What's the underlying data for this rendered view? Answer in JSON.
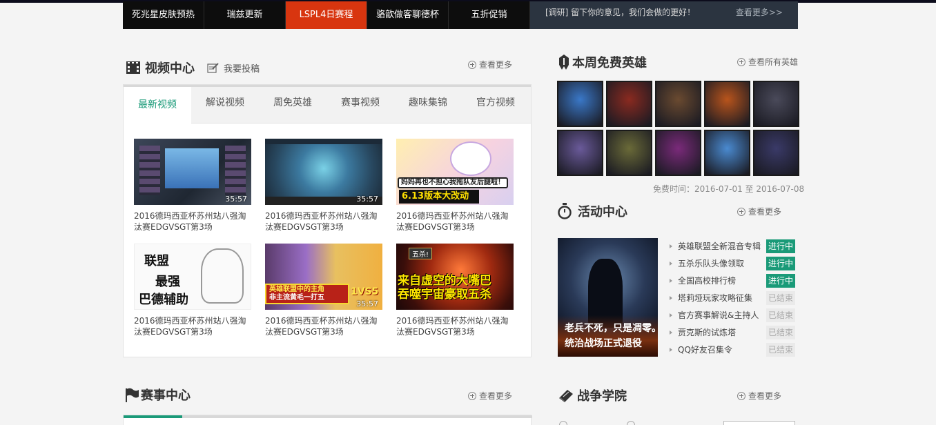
{
  "topnav": {
    "tabs": [
      "死兆星皮肤预热",
      "瑞兹更新",
      "LSPL4日赛程",
      "骆歆做客聊德杯",
      "五折促销"
    ],
    "active_index": 2
  },
  "survey": {
    "text": "[调研] 留下你的意见，我们会做的更好！",
    "more": "查看更多>>"
  },
  "video": {
    "title": "视频中心",
    "submit": "我要投稿",
    "more": "查看更多",
    "tabs": [
      "最新视频",
      "解说视频",
      "周免英雄",
      "赛事视频",
      "趣味集锦",
      "官方视频"
    ],
    "items": [
      {
        "caption": "2016德玛西亚杯苏州站八强淘汰赛EDGVSGT第3场",
        "duration": "35:57",
        "thumb": "match-broadcast"
      },
      {
        "caption": "2016德玛西亚杯苏州站八强淘汰赛EDGVSGT第3场",
        "duration": "35:57",
        "thumb": "gameplay"
      },
      {
        "caption": "2016德玛西亚杯苏州站八强淘汰赛EDGVSGT第3场",
        "duration": "",
        "thumb": "cartoon",
        "banner": "妈妈再也不担心我拖队友后腿啦！",
        "tag": "6.13版本大改动"
      },
      {
        "caption": "2016德玛西亚杯苏州站八强淘汰赛EDGVSGT第3场",
        "duration": "",
        "thumb": "sketch",
        "lines": [
          "联盟",
          "最强",
          "巴德辅助"
        ]
      },
      {
        "caption": "2016德玛西亚杯苏州站八强淘汰赛EDGVSGT第3场",
        "duration": "35:57",
        "thumb": "cosplay",
        "lines": [
          "英雄联盟中的主角",
          "非主流黄毛一打五"
        ],
        "tag": "1VS5"
      },
      {
        "caption": "2016德玛西亚杯苏州站八强淘汰赛EDGVSGT第3场",
        "duration": "",
        "thumb": "monster",
        "lines": [
          "来自虚空的大嘴巴",
          "吞噬宇宙豪取五杀"
        ],
        "tag": "五杀!"
      }
    ]
  },
  "heroes": {
    "title": "本周免费英雄",
    "more": "查看所有英雄",
    "portraits": [
      {
        "name": "ice-phoenix",
        "color": "#3a78c8"
      },
      {
        "name": "red-warrior",
        "color": "#8a2a20"
      },
      {
        "name": "bearded-gunman",
        "color": "#6a4a30"
      },
      {
        "name": "armored-warrior",
        "color": "#b8541c"
      },
      {
        "name": "masked-assassin",
        "color": "#4a4a5a"
      },
      {
        "name": "void-knight",
        "color": "#6a5a9a"
      },
      {
        "name": "rat-creature",
        "color": "#6a6a38"
      },
      {
        "name": "void-monster",
        "color": "#7a2a7a"
      },
      {
        "name": "blue-hair-sorceress",
        "color": "#4a8ad0"
      },
      {
        "name": "dark-wizard",
        "color": "#3a3a68"
      }
    ],
    "period": "免费时间：2016-07-01 至 2016-07-08"
  },
  "activity": {
    "title": "活动中心",
    "more": "查看更多",
    "image_text": [
      "老兵不死，只是凋零。",
      "统治战场正式退役"
    ],
    "items": [
      {
        "name": "英雄联盟全新混音专辑",
        "status": "进行中",
        "active": true
      },
      {
        "name": "五杀乐队头像领取",
        "status": "进行中",
        "active": true
      },
      {
        "name": "全国高校排行榜",
        "status": "进行中",
        "active": true
      },
      {
        "name": "塔莉垭玩家攻略征集",
        "status": "已结束",
        "active": false
      },
      {
        "name": "官方赛事解说&主持人",
        "status": "已结束",
        "active": false
      },
      {
        "name": "贾克斯的试炼塔",
        "status": "已结束",
        "active": false
      },
      {
        "name": "QQ好友召集令",
        "status": "已结束",
        "active": false
      }
    ]
  },
  "match": {
    "title": "赛事中心",
    "more": "查看更多"
  },
  "academy": {
    "title": "战争学院",
    "more": "查看更多"
  },
  "colors": {
    "accent": "#1a9a78",
    "active_tab": "#d8350f",
    "nav_bg": "#0d0d0d"
  }
}
